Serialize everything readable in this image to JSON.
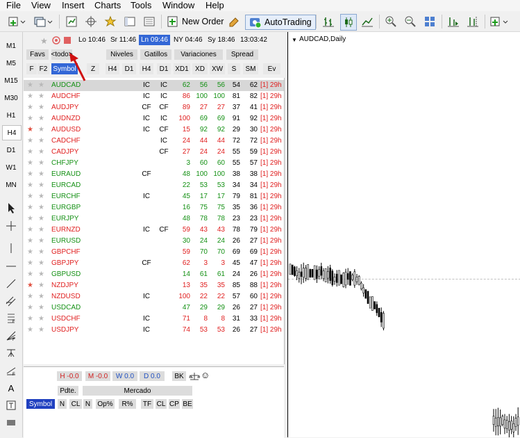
{
  "menu": [
    "File",
    "View",
    "Insert",
    "Charts",
    "Tools",
    "Window",
    "Help"
  ],
  "toolbar": {
    "new_order": "New Order",
    "autotrading": "AutoTrading"
  },
  "timeframes": [
    "M1",
    "M5",
    "M15",
    "M30",
    "H1",
    "H4",
    "D1",
    "W1",
    "MN"
  ],
  "active_timeframe": "H4",
  "sessions": [
    "Lo 10:46",
    "Sr 11:46",
    "Ln 09:46",
    "NY 04:46",
    "Sy 18:46",
    "13:03:42"
  ],
  "active_session": "Ln 09:46",
  "tabs": {
    "favs": "Favs",
    "todo": "<todo>",
    "niveles": "Niveles",
    "gatillos": "Gatillos",
    "variaciones": "Variaciones",
    "spread": "Spread"
  },
  "headers": [
    "F",
    "F2",
    "Symbol",
    "Z",
    "H4",
    "D1",
    "H4",
    "D1",
    "XD1",
    "XD",
    "XW",
    "S",
    "SM",
    "Ev"
  ],
  "rows": [
    {
      "sym": "AUDCAD",
      "c": "green",
      "z1": "IC",
      "z2": "IC",
      "a": "62",
      "b": "56",
      "d": "56",
      "s": "54",
      "sm": "62",
      "ev": "[1] 29h",
      "star": false,
      "sel": true
    },
    {
      "sym": "AUDCHF",
      "c": "red",
      "z1": "IC",
      "z2": "IC",
      "a": "86",
      "b": "100",
      "d": "100",
      "s": "81",
      "sm": "82",
      "ev": "[1] 29h",
      "star": false
    },
    {
      "sym": "AUDJPY",
      "c": "red",
      "z1": "CF",
      "z2": "CF",
      "a": "89",
      "b": "27",
      "d": "27",
      "s": "37",
      "sm": "41",
      "ev": "[1] 29h",
      "star": false
    },
    {
      "sym": "AUDNZD",
      "c": "red",
      "z1": "IC",
      "z2": "IC",
      "a": "100",
      "b": "69",
      "d": "69",
      "s": "91",
      "sm": "92",
      "ev": "[1] 29h",
      "star": false
    },
    {
      "sym": "AUDUSD",
      "c": "red",
      "z1": "IC",
      "z2": "CF",
      "a": "15",
      "b": "92",
      "d": "92",
      "s": "29",
      "sm": "30",
      "ev": "[1] 29h",
      "star": true
    },
    {
      "sym": "CADCHF",
      "c": "red",
      "z1": "",
      "z2": "IC",
      "a": "24",
      "b": "44",
      "d": "44",
      "s": "72",
      "sm": "72",
      "ev": "[1] 29h",
      "star": false
    },
    {
      "sym": "CADJPY",
      "c": "red",
      "z1": "",
      "z2": "CF",
      "a": "27",
      "b": "24",
      "d": "24",
      "s": "55",
      "sm": "59",
      "ev": "[1] 29h",
      "star": false
    },
    {
      "sym": "CHFJPY",
      "c": "green",
      "z1": "",
      "z2": "",
      "a": "3",
      "b": "60",
      "d": "60",
      "s": "55",
      "sm": "57",
      "ev": "[1] 29h",
      "star": false
    },
    {
      "sym": "EURAUD",
      "c": "green",
      "z1": "CF",
      "z2": "",
      "a": "48",
      "b": "100",
      "d": "100",
      "s": "38",
      "sm": "38",
      "ev": "[1] 29h",
      "star": false
    },
    {
      "sym": "EURCAD",
      "c": "green",
      "z1": "",
      "z2": "",
      "a": "22",
      "b": "53",
      "d": "53",
      "s": "34",
      "sm": "34",
      "ev": "[1] 29h",
      "star": false
    },
    {
      "sym": "EURCHF",
      "c": "green",
      "z1": "IC",
      "z2": "",
      "a": "45",
      "b": "17",
      "d": "17",
      "s": "79",
      "sm": "81",
      "ev": "[1] 29h",
      "star": false
    },
    {
      "sym": "EURGBP",
      "c": "green",
      "z1": "",
      "z2": "",
      "a": "16",
      "b": "75",
      "d": "75",
      "s": "35",
      "sm": "36",
      "ev": "[1] 29h",
      "star": false
    },
    {
      "sym": "EURJPY",
      "c": "green",
      "z1": "",
      "z2": "",
      "a": "48",
      "b": "78",
      "d": "78",
      "s": "23",
      "sm": "23",
      "ev": "[1] 29h",
      "star": false
    },
    {
      "sym": "EURNZD",
      "c": "red",
      "z1": "IC",
      "z2": "CF",
      "a": "59",
      "b": "43",
      "d": "43",
      "s": "78",
      "sm": "79",
      "ev": "[1] 29h",
      "star": false
    },
    {
      "sym": "EURUSD",
      "c": "green",
      "z1": "",
      "z2": "",
      "a": "30",
      "b": "24",
      "d": "24",
      "s": "26",
      "sm": "27",
      "ev": "[1] 29h",
      "star": false
    },
    {
      "sym": "GBPCHF",
      "c": "red",
      "z1": "",
      "z2": "",
      "a": "59",
      "b": "70",
      "d": "70",
      "s": "69",
      "sm": "69",
      "ev": "[1] 29h",
      "star": false
    },
    {
      "sym": "GBPJPY",
      "c": "red",
      "z1": "CF",
      "z2": "",
      "a": "62",
      "b": "3",
      "d": "3",
      "s": "45",
      "sm": "47",
      "ev": "[1] 29h",
      "star": false
    },
    {
      "sym": "GBPUSD",
      "c": "green",
      "z1": "",
      "z2": "",
      "a": "14",
      "b": "61",
      "d": "61",
      "s": "24",
      "sm": "26",
      "ev": "[1] 29h",
      "star": false
    },
    {
      "sym": "NZDJPY",
      "c": "red",
      "z1": "",
      "z2": "",
      "a": "13",
      "b": "35",
      "d": "35",
      "s": "85",
      "sm": "88",
      "ev": "[1] 29h",
      "star": true
    },
    {
      "sym": "NZDUSD",
      "c": "red",
      "z1": "IC",
      "z2": "",
      "a": "100",
      "b": "22",
      "d": "22",
      "s": "57",
      "sm": "60",
      "ev": "[1] 29h",
      "star": false
    },
    {
      "sym": "USDCAD",
      "c": "green",
      "z1": "",
      "z2": "",
      "a": "47",
      "b": "29",
      "d": "29",
      "s": "26",
      "sm": "27",
      "ev": "[1] 29h",
      "star": false
    },
    {
      "sym": "USDCHF",
      "c": "red",
      "z1": "IC",
      "z2": "",
      "a": "71",
      "b": "8",
      "d": "8",
      "s": "31",
      "sm": "33",
      "ev": "[1] 29h",
      "star": false
    },
    {
      "sym": "USDJPY",
      "c": "red",
      "z1": "IC",
      "z2": "",
      "a": "74",
      "b": "53",
      "d": "53",
      "s": "26",
      "sm": "27",
      "ev": "[1] 29h",
      "star": false
    }
  ],
  "bottom": {
    "h": "H",
    "h_val": "-0.0",
    "m": "M",
    "m_val": "-0.0",
    "w": "W",
    "w_val": "0.0",
    "d": "D",
    "d_val": "0.0",
    "bk": "BK",
    "pdte": "Pdte.",
    "mercado": "Mercado",
    "buttons": [
      "Symbol",
      "N",
      "CL",
      "N",
      "Op%",
      "R%",
      "TF",
      "CL",
      "CP",
      "BE"
    ]
  },
  "chart": {
    "title": "AUDCAD,Daily"
  },
  "colors": {
    "green": "#139013",
    "red": "#e02020",
    "selected_blue": "#3367d6"
  }
}
